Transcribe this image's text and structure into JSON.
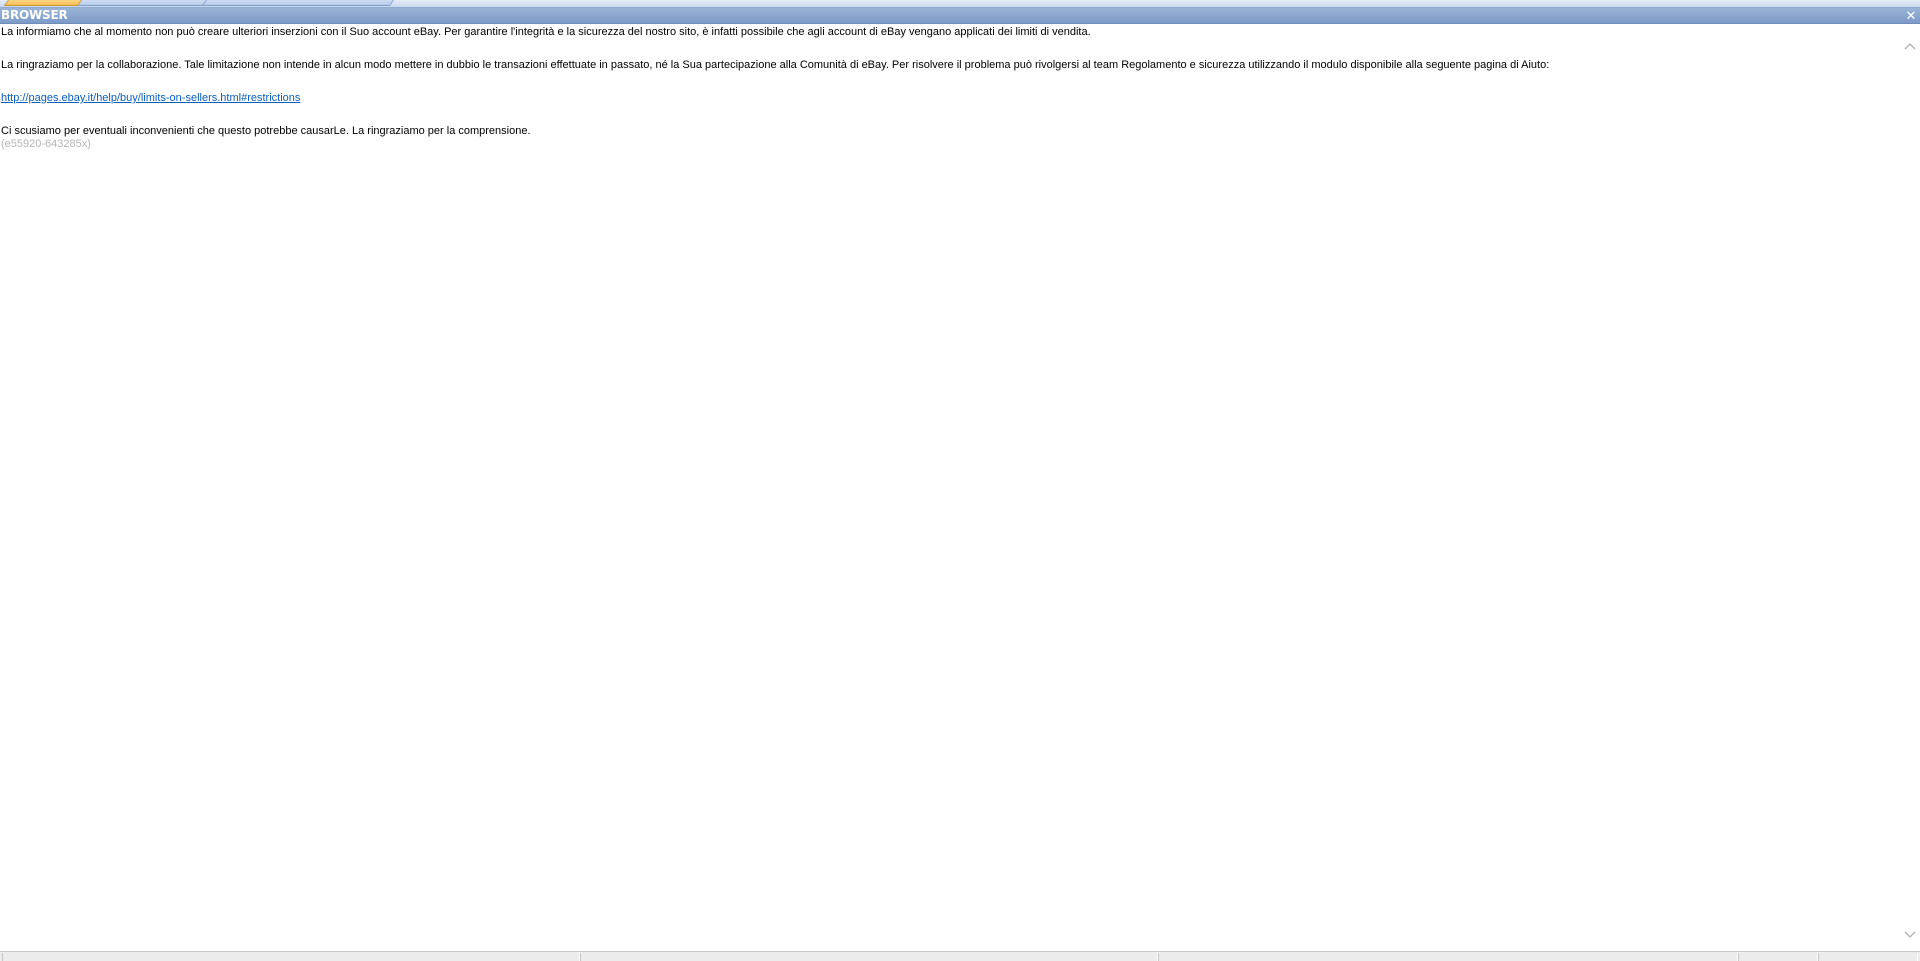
{
  "panel": {
    "title": "BROWSER",
    "close_symbol": "✕"
  },
  "content": {
    "paragraph_1": "La informiamo che al momento non può creare ulteriori inserzioni con il Suo account eBay. Per garantire l'integrità e la sicurezza del nostro sito, è infatti possibile che agli account di eBay vengano applicati dei limiti di vendita.",
    "paragraph_2": "La ringraziamo per la collaborazione. Tale limitazione non intende in alcun modo mettere in dubbio le transazioni effettuate in passato, né la Sua partecipazione alla Comunità di eBay. Per risolvere il problema può rivolgersi al team Regolamento e sicurezza utilizzando il modulo disponibile alla seguente pagina di Aiuto:",
    "help_link": "http://pages.ebay.it/help/buy/limits-on-sellers.html#restrictions",
    "paragraph_3": "Ci scusiamo per eventuali inconvenienti che questo potrebbe causarLe. La ringraziamo per la comprensione.",
    "reference_code": "(e55920-643285x)"
  },
  "icons": {
    "close": "close-icon",
    "scroll_up": "chevron-up-icon",
    "scroll_down": "chevron-down-icon"
  },
  "colors": {
    "titlebar": "#8aa6ce",
    "active_tab": "#f6c15b",
    "link": "#0b5fbf",
    "reference_code": "#b5b5b5"
  }
}
